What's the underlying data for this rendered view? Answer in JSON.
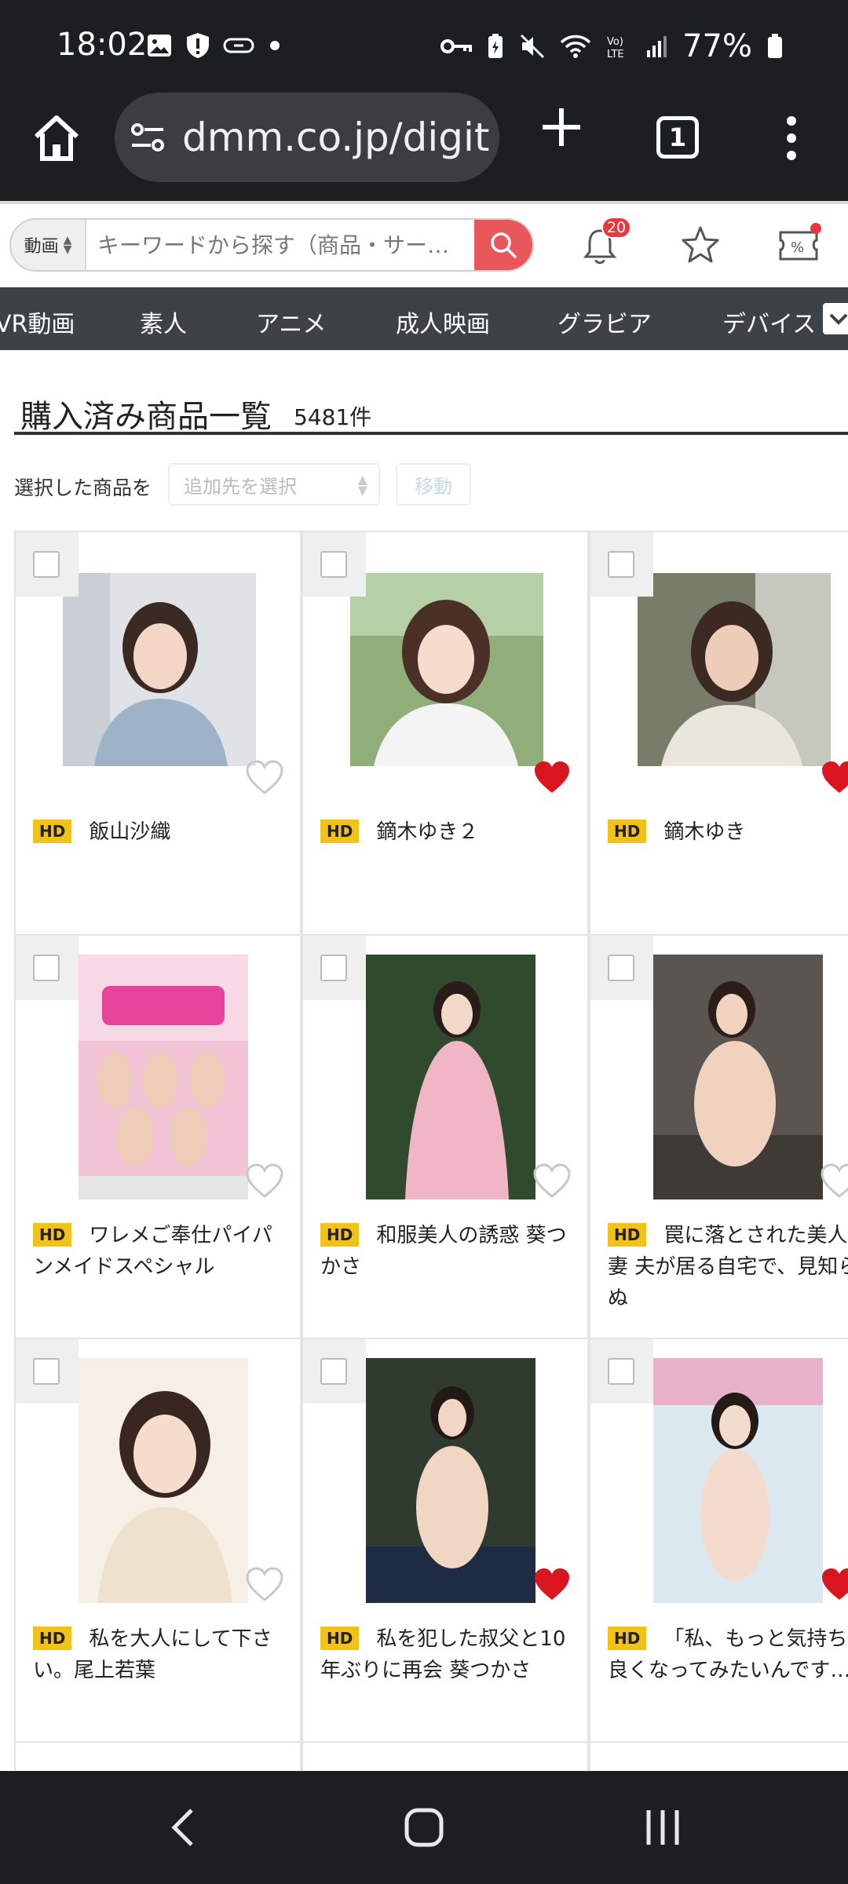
{
  "status_bar": {
    "time": "18:02",
    "battery": "77%",
    "left_icons": [
      "image-icon",
      "shield-alert-icon",
      "cast-icon",
      "dot-icon"
    ],
    "right_icons": [
      "key-icon",
      "battery-saver-icon",
      "mute-icon",
      "wifi-icon",
      "volte-icon",
      "signal-icon",
      "battery-icon"
    ]
  },
  "browser": {
    "url": "dmm.co.jp/digit",
    "tab_count": "1"
  },
  "header": {
    "search_category": "動画",
    "search_placeholder": "キーワードから探す（商品・サー…",
    "notification_count": "20"
  },
  "categories": [
    "VR動画",
    "素人",
    "アニメ",
    "成人映画",
    "グラビア",
    "デバイス"
  ],
  "page": {
    "title": "購入済み商品一覧",
    "count": "5481件",
    "action_label": "選択した商品を",
    "select_placeholder": "追加先を選択",
    "move_label": "移動"
  },
  "products": [
    {
      "badge": "HD",
      "title": "飯山沙織",
      "favorited": false
    },
    {
      "badge": "HD",
      "title": "鏑木ゆき２",
      "favorited": true
    },
    {
      "badge": "HD",
      "title": "鏑木ゆき",
      "favorited": true
    },
    {
      "badge": "HD",
      "title": "ワレメご奉仕パイパンメイドスペシャル",
      "favorited": false
    },
    {
      "badge": "HD",
      "title": "和服美人の誘惑 葵つかさ",
      "favorited": false
    },
    {
      "badge": "HD",
      "title": "罠に落とされた美人妻 夫が居る自宅で、見知らぬ",
      "favorited": false
    },
    {
      "badge": "HD",
      "title": "私を大人にして下さい。尾上若葉",
      "favorited": false
    },
    {
      "badge": "HD",
      "title": "私を犯した叔父と10年ぶりに再会 葵つかさ",
      "favorited": true
    },
    {
      "badge": "HD",
      "title": "「私、もっと気持ち良くなってみたいんです…」",
      "favorited": true
    }
  ],
  "colors": {
    "chrome_dark": "#1c1f22",
    "nav_bg": "#3c4246",
    "search_red": "#e9575a",
    "hd_badge": "#f2c21a",
    "heart_red": "#d9151f"
  }
}
